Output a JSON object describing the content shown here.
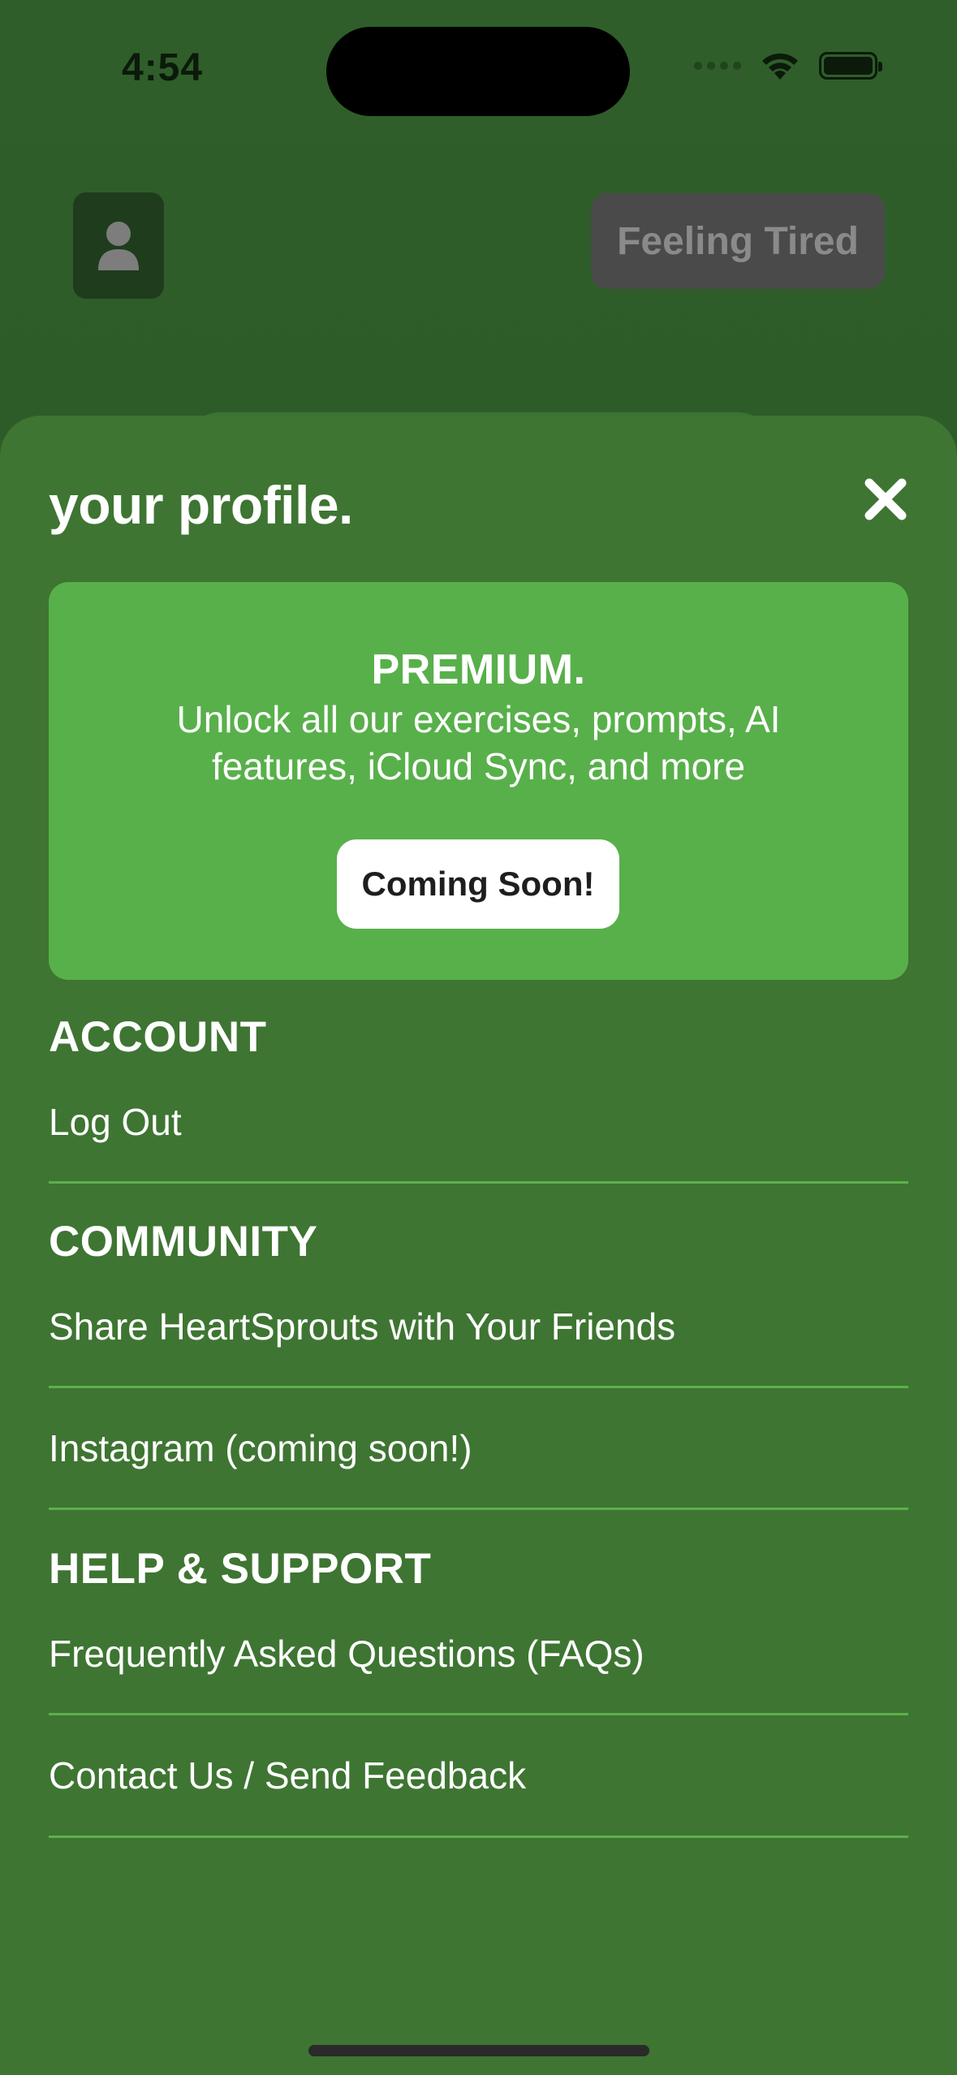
{
  "status_bar": {
    "time": "4:54"
  },
  "background": {
    "mood_button_label": "Feeling Tired"
  },
  "sheet": {
    "title": "your profile.",
    "premium": {
      "title": "PREMIUM.",
      "description": "Unlock all our exercises, prompts, AI features, iCloud Sync, and more",
      "button_label": "Coming Soon!"
    },
    "sections": [
      {
        "header": "ACCOUNT",
        "items": [
          "Log Out"
        ]
      },
      {
        "header": "COMMUNITY",
        "items": [
          "Share HeartSprouts with Your Friends",
          "Instagram (coming soon!)"
        ]
      },
      {
        "header": "HELP & SUPPORT",
        "items": [
          "Frequently Asked Questions (FAQs)",
          "Contact Us / Send Feedback"
        ]
      }
    ]
  },
  "colors": {
    "background": "#2d5a27",
    "sheet": "#3e7532",
    "premium_card": "#58b04a",
    "divider": "#5cb04c",
    "text": "#ffffff"
  },
  "icons": {
    "profile": "person-icon",
    "close": "close-icon",
    "wifi": "wifi-icon",
    "battery": "battery-icon",
    "signal": "signal-icon"
  }
}
